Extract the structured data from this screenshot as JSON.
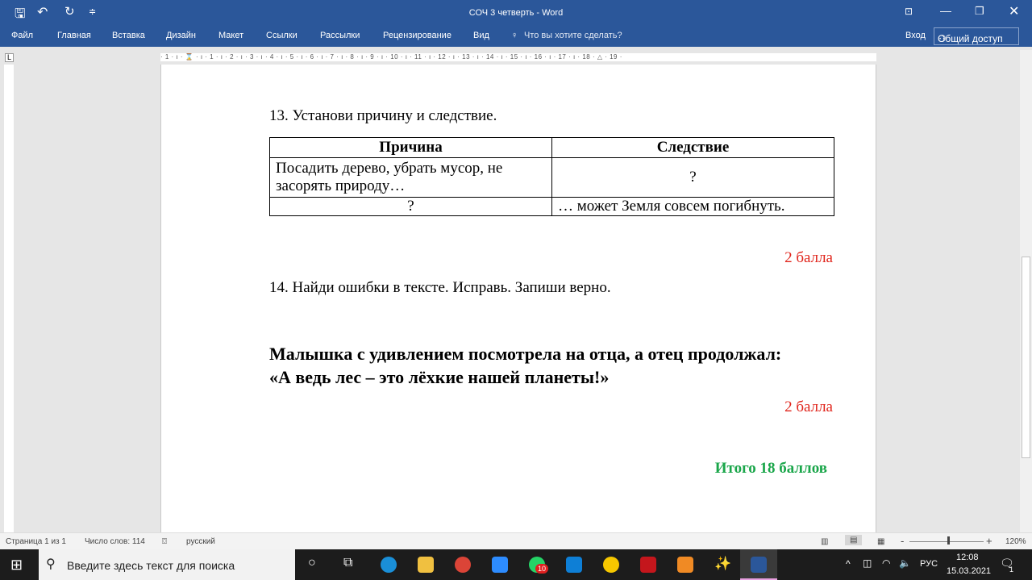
{
  "window": {
    "title": "СОЧ 3 четверть - Word",
    "signin": "Вход",
    "share": "Общий доступ"
  },
  "ribbon": {
    "tabs": [
      "Файл",
      "Главная",
      "Вставка",
      "Дизайн",
      "Макет",
      "Ссылки",
      "Рассылки",
      "Рецензирование",
      "Вид"
    ],
    "tell_me": "Что вы хотите сделать?"
  },
  "ruler": {
    "text": "· 1 · ı · ⌛ · ı · 1 · ı · 2 · ı · 3 · ı · 4 · ı · 5 · ı · 6 · ı · 7 · ı · 8 · ı · 9 · ı · 10 · ı · 11 · ı · 12 · ı · 13 · ı · 14 · ı · 15 · ı · 16 · ı · 17 · ı · 18 · △ · 19 ·"
  },
  "doc": {
    "q13": "13. Установи причину и следствие.",
    "table": {
      "headers": [
        "Причина",
        "Следствие"
      ],
      "rows": [
        [
          "Посадить дерево, убрать мусор, не засорять природу…",
          "?"
        ],
        [
          "?",
          "… может Земля совсем погибнуть."
        ]
      ]
    },
    "score1": "2 балла",
    "q14": "14. Найди ошибки в тексте. Исправь. Запиши верно.",
    "bold_line1": "Малышка с удивлением посмотрела на отца, а отец продолжал:",
    "bold_line2": "«А ведь лес – это лёхкие нашей планеты!»",
    "score2": "2 балла",
    "total": "Итого 18 баллов"
  },
  "status": {
    "page": "Страница 1 из 1",
    "words": "Число слов: 114",
    "language": "русский",
    "zoom": "120%"
  },
  "taskbar": {
    "search_placeholder": "Введите здесь текст для поиска",
    "lang": "РУС",
    "time": "12:08",
    "date": "15.03.2021",
    "whatsapp_badge": "10",
    "notif": "1"
  },
  "colors": {
    "word_blue": "#2b579a",
    "red": "#e0241b",
    "green": "#1aa64a"
  }
}
